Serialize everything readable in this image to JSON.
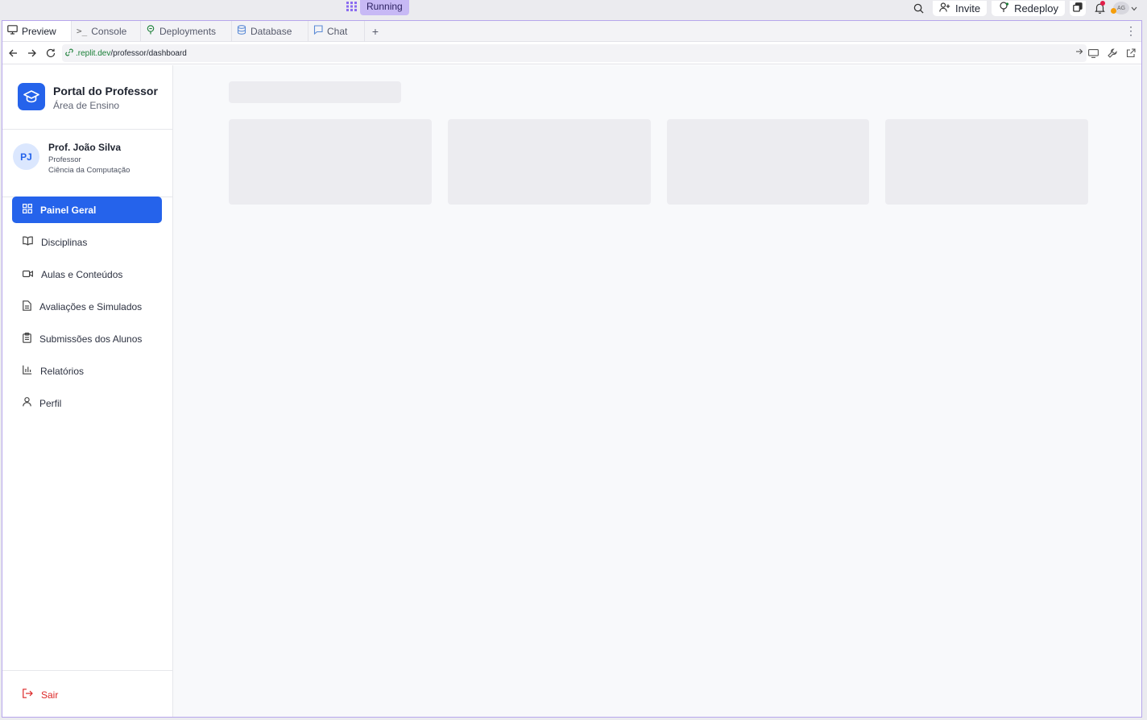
{
  "topbar": {
    "status_label": "Running",
    "invite_label": "Invite",
    "redeploy_label": "Redeploy",
    "avatar_initials": "AG",
    "icons": [
      "search-icon",
      "add-user-icon",
      "redeploy-icon",
      "copy-icon",
      "bell-icon",
      "chevron-down-icon"
    ]
  },
  "tabs": [
    {
      "label": "Preview",
      "icon": "monitor-icon",
      "active": true
    },
    {
      "label": "Console",
      "icon": "terminal-icon",
      "active": false
    },
    {
      "label": "Deployments",
      "icon": "deploy-icon",
      "active": false
    },
    {
      "label": "Database",
      "icon": "database-icon",
      "active": false
    },
    {
      "label": "Chat",
      "icon": "chat-icon",
      "active": false
    }
  ],
  "urlbar": {
    "domain": ".replit.dev",
    "path": "/professor/dashboard"
  },
  "brand": {
    "title": "Portal do Professor",
    "subtitle": "Área de Ensino"
  },
  "user": {
    "initials": "PJ",
    "name": "Prof. João Silva",
    "role": "Professor",
    "department": "Ciência da Computação"
  },
  "menu": [
    {
      "label": "Painel Geral",
      "icon": "grid-icon",
      "active": true
    },
    {
      "label": "Disciplinas",
      "icon": "book-icon",
      "active": false
    },
    {
      "label": "Aulas e Conteúdos",
      "icon": "video-icon",
      "active": false
    },
    {
      "label": "Avaliações e Simulados",
      "icon": "document-icon",
      "active": false
    },
    {
      "label": "Submissões dos Alunos",
      "icon": "clipboard-icon",
      "active": false
    },
    {
      "label": "Relatórios",
      "icon": "bar-chart-icon",
      "active": false
    },
    {
      "label": "Perfil",
      "icon": "user-icon",
      "active": false
    }
  ],
  "logout_label": "Sair",
  "colors": {
    "accent": "#2563eb",
    "danger": "#dc2626",
    "running_badge": "#c7b9f5"
  }
}
